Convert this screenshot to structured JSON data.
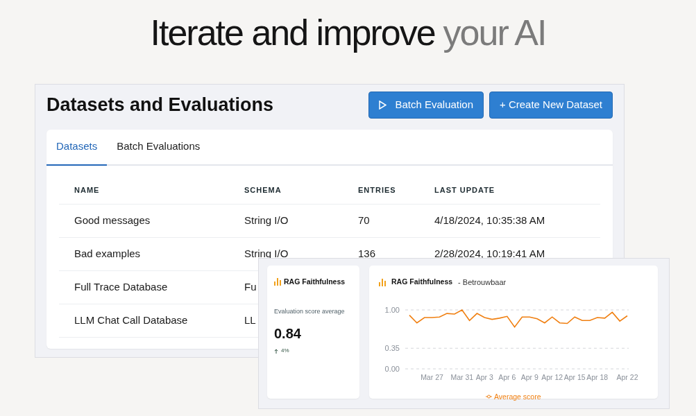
{
  "headline": [
    {
      "text": "Iterate and improve",
      "muted": false
    },
    {
      "text": "your AI",
      "muted": true
    }
  ],
  "panel": {
    "title": "Datasets and Evaluations",
    "buttons": [
      {
        "label": "Batch Evaluation",
        "kind": "play"
      },
      {
        "label": "+ Create New Dataset",
        "kind": "plain"
      }
    ],
    "tabs": [
      {
        "label": "Datasets",
        "selected": true
      },
      {
        "label": "Batch Evaluations",
        "selected": false
      }
    ],
    "table": {
      "columns": [
        "NAME",
        "SCHEMA",
        "ENTRIES",
        "LAST UPDATE"
      ],
      "rows": [
        [
          "Good messages",
          "String I/O",
          "70",
          "4/18/2024, 10:35:38 AM"
        ],
        [
          "Bad examples",
          "String I/O",
          "136",
          "2/28/2024, 10:19:41 AM"
        ],
        [
          "Full Trace Database",
          "Fu"
        ],
        [
          "LLM Chat Call Database",
          "LL"
        ]
      ]
    }
  },
  "overlay": {
    "stat_card": {
      "title": "RAG Faithfulness",
      "label": "Evaluation score average",
      "value": "0.84",
      "change": "4%"
    },
    "chart_card": {
      "title": "RAG Faithfulness",
      "subtitle": "- Betrouwbaar",
      "chart_data": {
        "type": "line",
        "categories": [
          null,
          null,
          null,
          "Mar 27",
          null,
          null,
          null,
          "Mar 31",
          null,
          null,
          "Apr 3",
          null,
          null,
          "Apr 6",
          null,
          null,
          "Apr 9",
          null,
          null,
          "Apr 12",
          null,
          null,
          "Apr 15",
          null,
          null,
          "Apr 18",
          null,
          null,
          null,
          "Apr 22"
        ],
        "series": [
          {
            "name": "Average score",
            "color": "#f07f10",
            "values": [
              0.91,
              0.78,
              0.87,
              0.87,
              0.88,
              0.94,
              0.93,
              1.0,
              0.82,
              0.94,
              0.87,
              0.84,
              0.86,
              0.89,
              0.71,
              0.88,
              0.88,
              0.85,
              0.78,
              0.88,
              0.78,
              0.77,
              0.88,
              0.82,
              0.82,
              0.87,
              0.86,
              0.96,
              0.81,
              0.9
            ]
          }
        ],
        "ylim": [
          0,
          1
        ],
        "yticks": [
          {
            "value": 0,
            "label": "0.00"
          },
          {
            "value": 0.35,
            "label": "0.35"
          },
          {
            "value": 1,
            "label": "1.00"
          }
        ]
      }
    }
  }
}
